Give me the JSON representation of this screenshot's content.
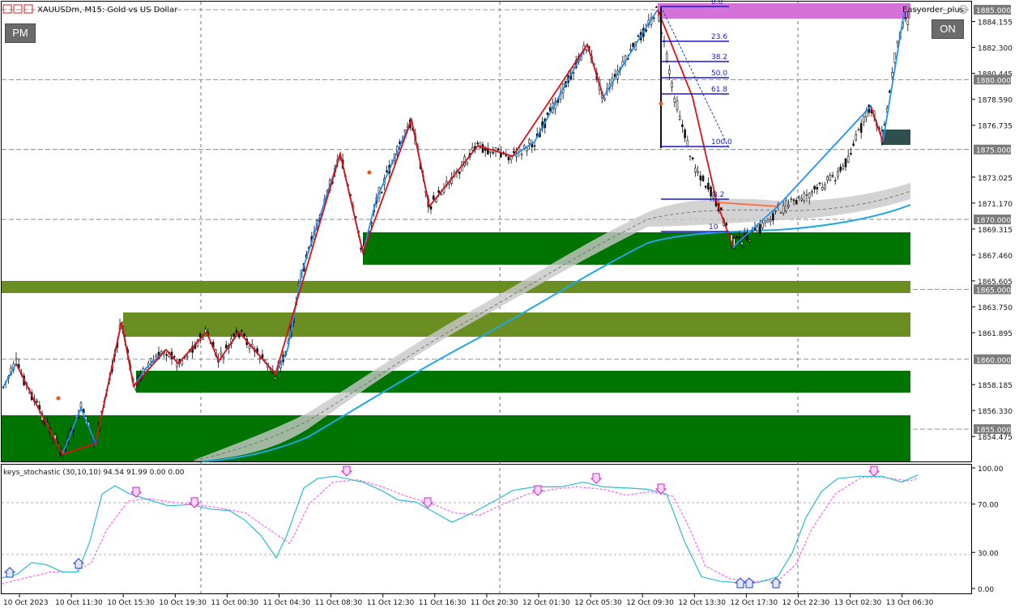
{
  "header": {
    "symbol_label": "XAUUSDm, M15:  Gold vs US Dollar",
    "expert_label": "Easyorder_plus"
  },
  "buttons": {
    "pm": "PM",
    "on": "ON"
  },
  "price_axis": {
    "ticks": [
      {
        "label": "1884.155",
        "value": 1884.155
      },
      {
        "label": "1882.300",
        "value": 1882.3
      },
      {
        "label": "1880.445",
        "value": 1880.445
      },
      {
        "label": "1878.590",
        "value": 1878.59
      },
      {
        "label": "1876.735",
        "value": 1876.735
      },
      {
        "label": "1873.025",
        "value": 1873.025
      },
      {
        "label": "1871.170",
        "value": 1871.17
      },
      {
        "label": "1869.315",
        "value": 1869.315
      },
      {
        "label": "1867.460",
        "value": 1867.46
      },
      {
        "label": "1865.605",
        "value": 1865.605
      },
      {
        "label": "1863.750",
        "value": 1863.75
      },
      {
        "label": "1861.895",
        "value": 1861.895
      },
      {
        "label": "1858.185",
        "value": 1858.185
      },
      {
        "label": "1856.330",
        "value": 1856.33
      },
      {
        "label": "1854.475",
        "value": 1854.475
      }
    ],
    "level_labels": [
      {
        "label": "1885.000",
        "value": 1885.0
      },
      {
        "label": "1880.000",
        "value": 1880.0
      },
      {
        "label": "1875.000",
        "value": 1875.0
      },
      {
        "label": "1870.000",
        "value": 1870.0
      },
      {
        "label": "1865.000",
        "value": 1865.0
      },
      {
        "label": "1860.000",
        "value": 1860.0
      },
      {
        "label": "1855.000",
        "value": 1855.0
      }
    ]
  },
  "time_axis": {
    "labels": [
      "10 Oct 2023",
      "10 Oct 11:30",
      "10 Oct 15:30",
      "10 Oct 19:30",
      "11 Oct 00:30",
      "11 Oct 04:30",
      "11 Oct 08:30",
      "11 Oct 12:30",
      "11 Oct 16:30",
      "11 Oct 20:30",
      "12 Oct 01:30",
      "12 Oct 05:30",
      "12 Oct 09:30",
      "12 Oct 13:30",
      "12 Oct 17:30",
      "12 Oct 22:30",
      "13 Oct 02:30",
      "13 Oct 06:30"
    ]
  },
  "fibonacci": {
    "levels": [
      "0.0",
      "23.6",
      "38.2",
      "50.0",
      "61.8",
      "100.0"
    ],
    "lower_fragments": [
      "8.2",
      "10"
    ]
  },
  "indicator": {
    "title": "keys_stochastic (30,10,10) 94.54 91.99 0.00 0.00",
    "scale": [
      {
        "label": "100.00",
        "value": 100
      },
      {
        "label": "70.00",
        "value": 70
      },
      {
        "label": "30.00",
        "value": 30
      },
      {
        "label": "0.00",
        "value": 0
      }
    ],
    "main_series": [
      [
        0,
        0.09
      ],
      [
        0.019,
        0.12
      ],
      [
        0.037,
        0.22
      ],
      [
        0.056,
        0.2
      ],
      [
        0.075,
        0.14
      ],
      [
        0.094,
        0.14
      ],
      [
        0.109,
        0.4
      ],
      [
        0.124,
        0.8
      ],
      [
        0.14,
        0.87
      ],
      [
        0.158,
        0.8
      ],
      [
        0.182,
        0.75
      ],
      [
        0.206,
        0.7
      ],
      [
        0.233,
        0.71
      ],
      [
        0.26,
        0.67
      ],
      [
        0.281,
        0.66
      ],
      [
        0.3,
        0.58
      ],
      [
        0.32,
        0.45
      ],
      [
        0.339,
        0.26
      ],
      [
        0.352,
        0.45
      ],
      [
        0.373,
        0.85
      ],
      [
        0.39,
        0.93
      ],
      [
        0.412,
        0.95
      ],
      [
        0.446,
        0.9
      ],
      [
        0.469,
        0.83
      ],
      [
        0.489,
        0.75
      ],
      [
        0.512,
        0.73
      ],
      [
        0.533,
        0.65
      ],
      [
        0.556,
        0.56
      ],
      [
        0.581,
        0.64
      ],
      [
        0.611,
        0.75
      ],
      [
        0.631,
        0.83
      ],
      [
        0.658,
        0.86
      ],
      [
        0.691,
        0.86
      ],
      [
        0.718,
        0.9
      ],
      [
        0.743,
        0.86
      ],
      [
        0.774,
        0.85
      ],
      [
        0.797,
        0.84
      ],
      [
        0.821,
        0.8
      ],
      [
        0.843,
        0.4
      ],
      [
        0.864,
        0.1
      ],
      [
        0.888,
        0.06
      ],
      [
        0.91,
        0.05
      ],
      [
        0.934,
        0.05
      ],
      [
        0.958,
        0.1
      ],
      [
        0.976,
        0.3
      ],
      [
        0.993,
        0.6
      ],
      [
        1.012,
        0.82
      ],
      [
        1.032,
        0.93
      ],
      [
        1.059,
        0.95
      ],
      [
        1.087,
        0.95
      ],
      [
        1.111,
        0.9
      ],
      [
        1.131,
        0.96
      ]
    ],
    "signal_series": [
      [
        0,
        0.04
      ],
      [
        0.03,
        0.09
      ],
      [
        0.06,
        0.14
      ],
      [
        0.09,
        0.14
      ],
      [
        0.111,
        0.22
      ],
      [
        0.13,
        0.5
      ],
      [
        0.156,
        0.74
      ],
      [
        0.181,
        0.76
      ],
      [
        0.211,
        0.73
      ],
      [
        0.241,
        0.71
      ],
      [
        0.27,
        0.68
      ],
      [
        0.301,
        0.64
      ],
      [
        0.33,
        0.5
      ],
      [
        0.356,
        0.38
      ],
      [
        0.38,
        0.72
      ],
      [
        0.409,
        0.9
      ],
      [
        0.44,
        0.92
      ],
      [
        0.47,
        0.86
      ],
      [
        0.5,
        0.78
      ],
      [
        0.53,
        0.72
      ],
      [
        0.559,
        0.64
      ],
      [
        0.59,
        0.62
      ],
      [
        0.621,
        0.72
      ],
      [
        0.65,
        0.8
      ],
      [
        0.68,
        0.84
      ],
      [
        0.709,
        0.86
      ],
      [
        0.743,
        0.84
      ],
      [
        0.771,
        0.79
      ],
      [
        0.8,
        0.82
      ],
      [
        0.829,
        0.78
      ],
      [
        0.85,
        0.5
      ],
      [
        0.869,
        0.19
      ],
      [
        0.9,
        0.08
      ],
      [
        0.929,
        0.06
      ],
      [
        0.959,
        0.07
      ],
      [
        0.98,
        0.2
      ],
      [
        1.0,
        0.5
      ],
      [
        1.029,
        0.8
      ],
      [
        1.061,
        0.94
      ],
      [
        1.09,
        0.94
      ],
      [
        1.12,
        0.91
      ],
      [
        1.131,
        0.93
      ]
    ]
  }
}
